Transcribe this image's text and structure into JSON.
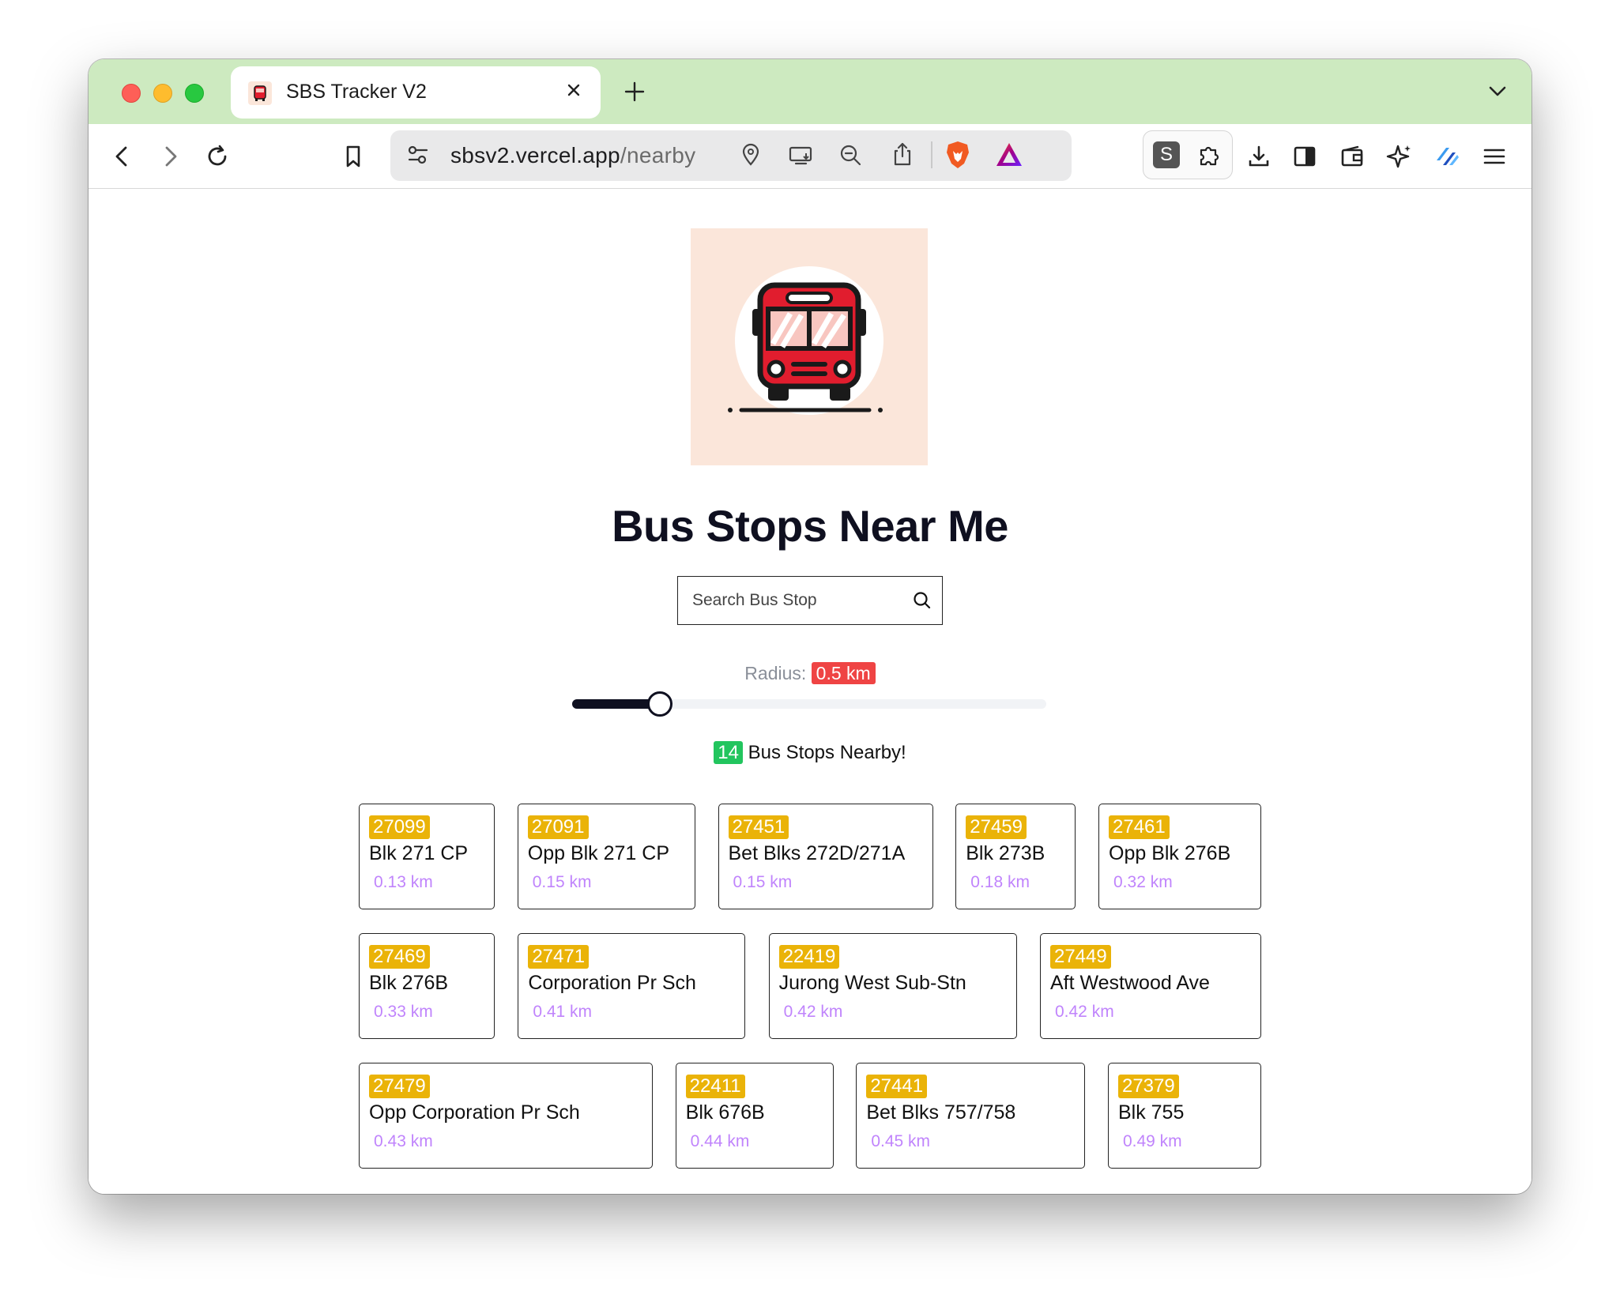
{
  "browser": {
    "tab_title": "SBS Tracker V2",
    "url_host": "sbsv2.vercel.app",
    "url_path": "/nearby"
  },
  "page": {
    "title": "Bus Stops Near Me",
    "search_placeholder": "Search Bus Stop",
    "radius_label": "Radius:",
    "radius_value": "0.5 km",
    "radius_fraction": 0.185,
    "count": "14",
    "count_label": "Bus Stops Nearby!"
  },
  "colors": {
    "tabstrip": "#cdeac0",
    "logo_bg": "#fbe6da",
    "radius_badge": "#ef4444",
    "count_badge": "#22c55e",
    "code_badge": "#eab308",
    "distance": "#c084fc"
  },
  "stops": [
    {
      "code": "27099",
      "name": "Blk 271 CP",
      "distance": "0.13 km"
    },
    {
      "code": "27091",
      "name": "Opp Blk 271 CP",
      "distance": "0.15 km"
    },
    {
      "code": "27451",
      "name": "Bet Blks 272D/271A",
      "distance": "0.15 km"
    },
    {
      "code": "27459",
      "name": "Blk 273B",
      "distance": "0.18 km"
    },
    {
      "code": "27461",
      "name": "Opp Blk 276B",
      "distance": "0.32 km"
    },
    {
      "code": "27469",
      "name": "Blk 276B",
      "distance": "0.33 km"
    },
    {
      "code": "27471",
      "name": "Corporation Pr Sch",
      "distance": "0.41 km"
    },
    {
      "code": "22419",
      "name": "Jurong West Sub-Stn",
      "distance": "0.42 km"
    },
    {
      "code": "27449",
      "name": "Aft Westwood Ave",
      "distance": "0.42 km"
    },
    {
      "code": "27479",
      "name": "Opp Corporation Pr Sch",
      "distance": "0.43 km"
    },
    {
      "code": "22411",
      "name": "Blk 676B",
      "distance": "0.44 km"
    },
    {
      "code": "27441",
      "name": "Bet Blks 757/758",
      "distance": "0.45 km"
    },
    {
      "code": "27379",
      "name": "Blk 755",
      "distance": "0.49 km"
    }
  ]
}
